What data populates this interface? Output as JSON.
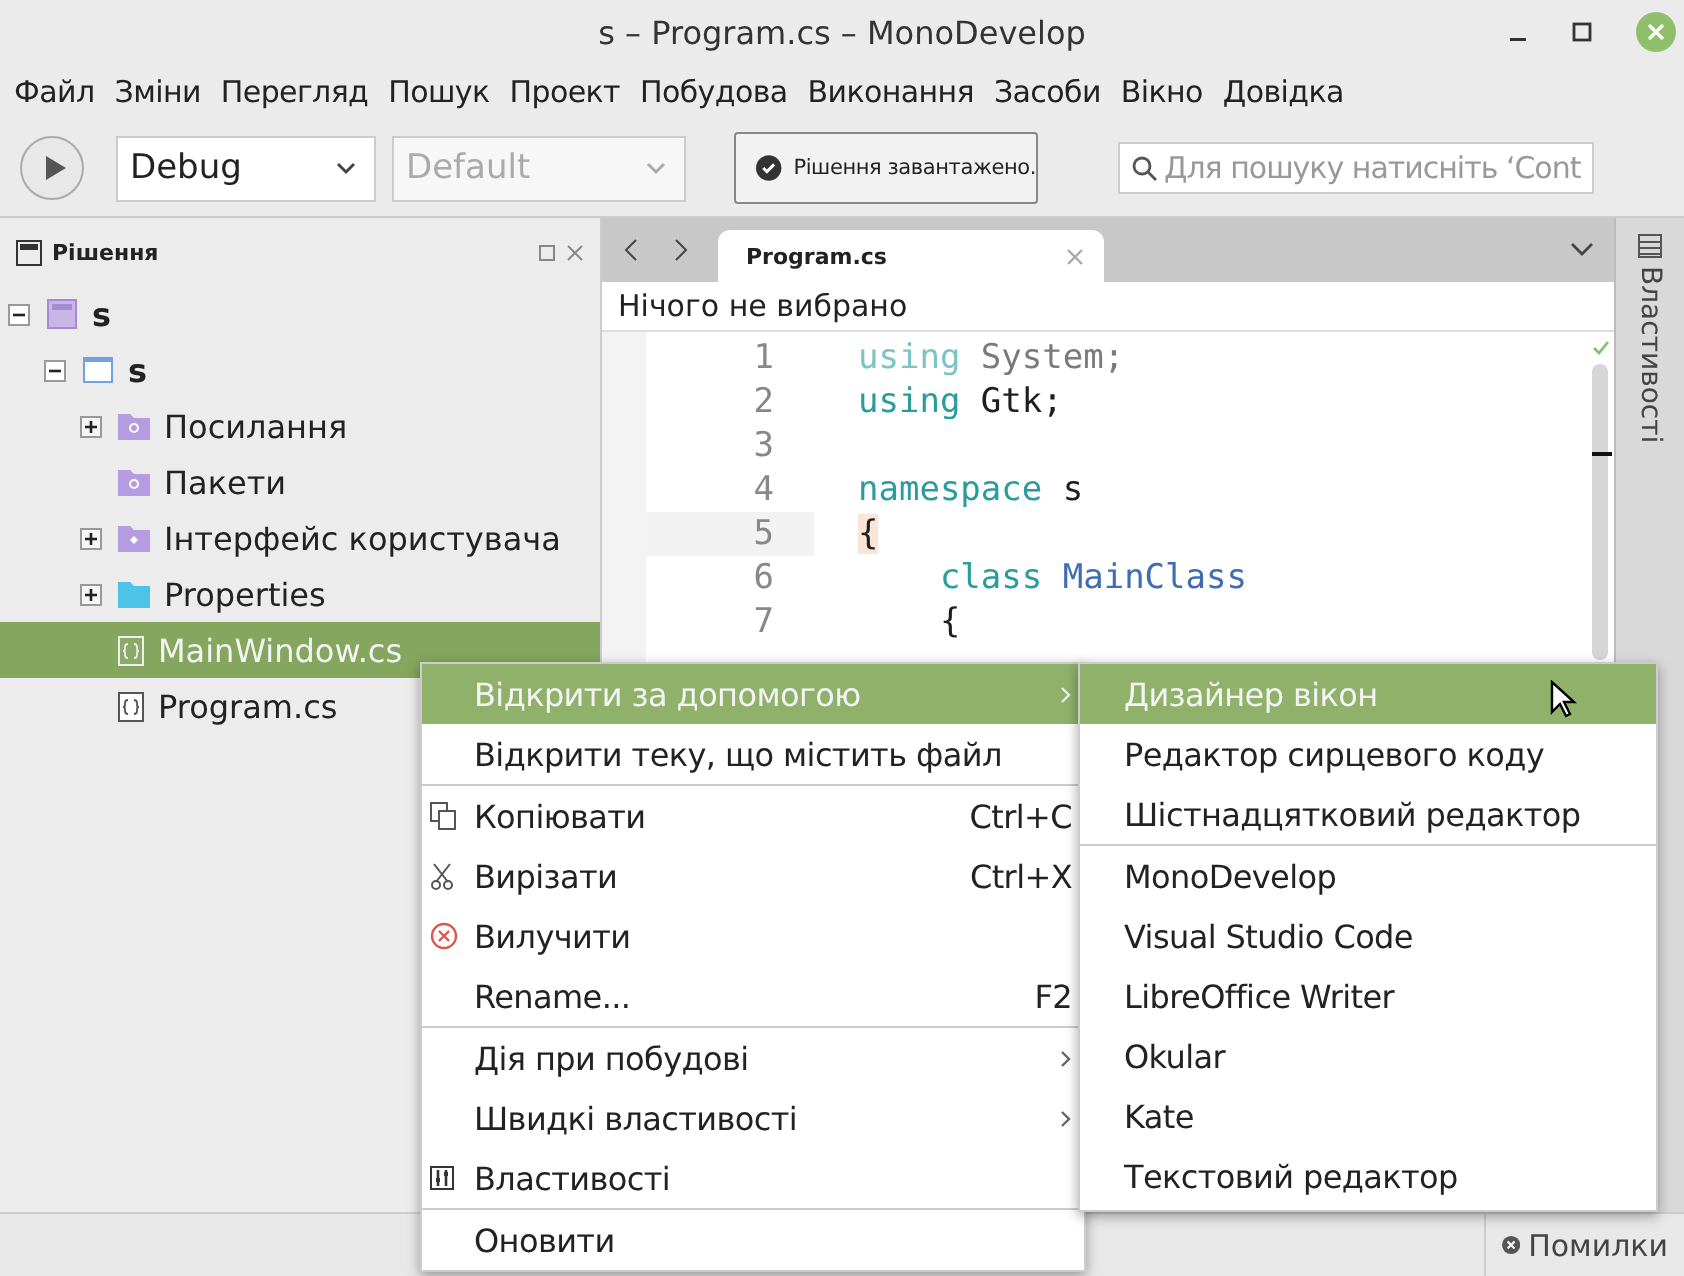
{
  "window": {
    "title": "s – Program.cs – MonoDevelop"
  },
  "menubar": [
    "Файл",
    "Зміни",
    "Перегляд",
    "Пошук",
    "Проект",
    "Побудова",
    "Виконання",
    "Засоби",
    "Вікно",
    "Довідка"
  ],
  "toolbar": {
    "configuration": {
      "value": "Debug",
      "disabled": false
    },
    "platform": {
      "value": "Default",
      "disabled": true
    },
    "status": "Рішення завантажено.",
    "search": {
      "placeholder": "Для пошуку натисніть ‘Cont"
    }
  },
  "solution_pad": {
    "title": "Рішення",
    "tree": [
      {
        "label": "s",
        "kind": "solution",
        "expanded": true,
        "selected": false,
        "children": [
          {
            "label": "s",
            "kind": "project",
            "expanded": true,
            "selected": false,
            "children": [
              {
                "label": "Посилання",
                "kind": "references",
                "expanded": false,
                "selected": false
              },
              {
                "label": "Пакети",
                "kind": "packages",
                "selected": false
              },
              {
                "label": "Інтерфейс користувача",
                "kind": "gui",
                "expanded": false,
                "selected": false
              },
              {
                "label": "Properties",
                "kind": "folder",
                "expanded": false,
                "selected": false
              },
              {
                "label": "MainWindow.cs",
                "kind": "file",
                "selected": true
              },
              {
                "label": "Program.cs",
                "kind": "file",
                "selected": false
              }
            ]
          }
        ]
      }
    ]
  },
  "editor": {
    "tabs": [
      {
        "label": "Program.cs",
        "selected": true
      }
    ],
    "breadcrumb": "Нічого не вибрано",
    "lines": [
      {
        "number": "1",
        "current": false,
        "tokens": [
          {
            "kind": "dim-keyword",
            "text": "using"
          },
          {
            "kind": "dim",
            "text": " System;"
          }
        ]
      },
      {
        "number": "2",
        "current": false,
        "tokens": [
          {
            "kind": "keyword",
            "text": "using"
          },
          {
            "kind": "plain",
            "text": " Gtk;"
          }
        ]
      },
      {
        "number": "3",
        "current": false
      },
      {
        "number": "4",
        "current": false,
        "tokens": [
          {
            "kind": "keyword",
            "text": "namespace"
          },
          {
            "kind": "plain",
            "text": " s"
          }
        ]
      },
      {
        "number": "5",
        "current": true,
        "tokens": [
          {
            "kind": "bracket-match",
            "text": "{"
          }
        ]
      },
      {
        "number": "6",
        "current": false,
        "tokens": [
          {
            "kind": "keyword",
            "text": "    class"
          },
          {
            "kind": "type",
            "text": " MainClass"
          }
        ]
      },
      {
        "number": "7",
        "current": false,
        "tokens": [
          {
            "kind": "plain",
            "text": "    {"
          }
        ]
      }
    ]
  },
  "context_menu": [
    {
      "kind": "item",
      "label": "Відкрити за допомогою",
      "submenu": true,
      "selected": true
    },
    {
      "kind": "item",
      "label": "Відкрити теку, що містить файл",
      "submenu": false,
      "selected": false
    },
    {
      "kind": "separator"
    },
    {
      "kind": "copy",
      "label": "Копіювати",
      "shortcut": "Ctrl+C",
      "submenu": false,
      "selected": false
    },
    {
      "kind": "cut",
      "label": "Вирізати",
      "shortcut": "Ctrl+X",
      "submenu": false,
      "selected": false
    },
    {
      "kind": "delete",
      "label": "Вилучити",
      "submenu": false,
      "selected": false
    },
    {
      "kind": "item",
      "label": "Rename...",
      "shortcut": "F2",
      "submenu": false,
      "selected": false
    },
    {
      "kind": "separator"
    },
    {
      "kind": "item",
      "label": "Дія при побудові",
      "submenu": true,
      "selected": false
    },
    {
      "kind": "item",
      "label": "Швидкі властивості",
      "submenu": true,
      "selected": false
    },
    {
      "kind": "properties",
      "label": "Властивості",
      "submenu": false,
      "selected": false
    },
    {
      "kind": "separator"
    },
    {
      "kind": "item",
      "label": "Оновити",
      "submenu": false,
      "selected": false
    }
  ],
  "submenu": [
    {
      "kind": "item",
      "label": "Дизайнер вікон",
      "selected": true
    },
    {
      "kind": "item",
      "label": "Редактор сирцевого коду",
      "selected": false
    },
    {
      "kind": "item",
      "label": "Шістнадцятковий редактор",
      "selected": false
    },
    {
      "kind": "separator"
    },
    {
      "kind": "item",
      "label": "MonoDevelop",
      "selected": false
    },
    {
      "kind": "item",
      "label": "Visual Studio Code",
      "selected": false
    },
    {
      "kind": "item",
      "label": "LibreOffice Writer",
      "selected": false
    },
    {
      "kind": "item",
      "label": "Okular",
      "selected": false
    },
    {
      "kind": "item",
      "label": "Kate",
      "selected": false
    },
    {
      "kind": "item",
      "label": "Текстовий редактор",
      "selected": false
    }
  ],
  "side_pad": {
    "label": "Властивості"
  },
  "status_bar": {
    "errors": "Помилки"
  }
}
